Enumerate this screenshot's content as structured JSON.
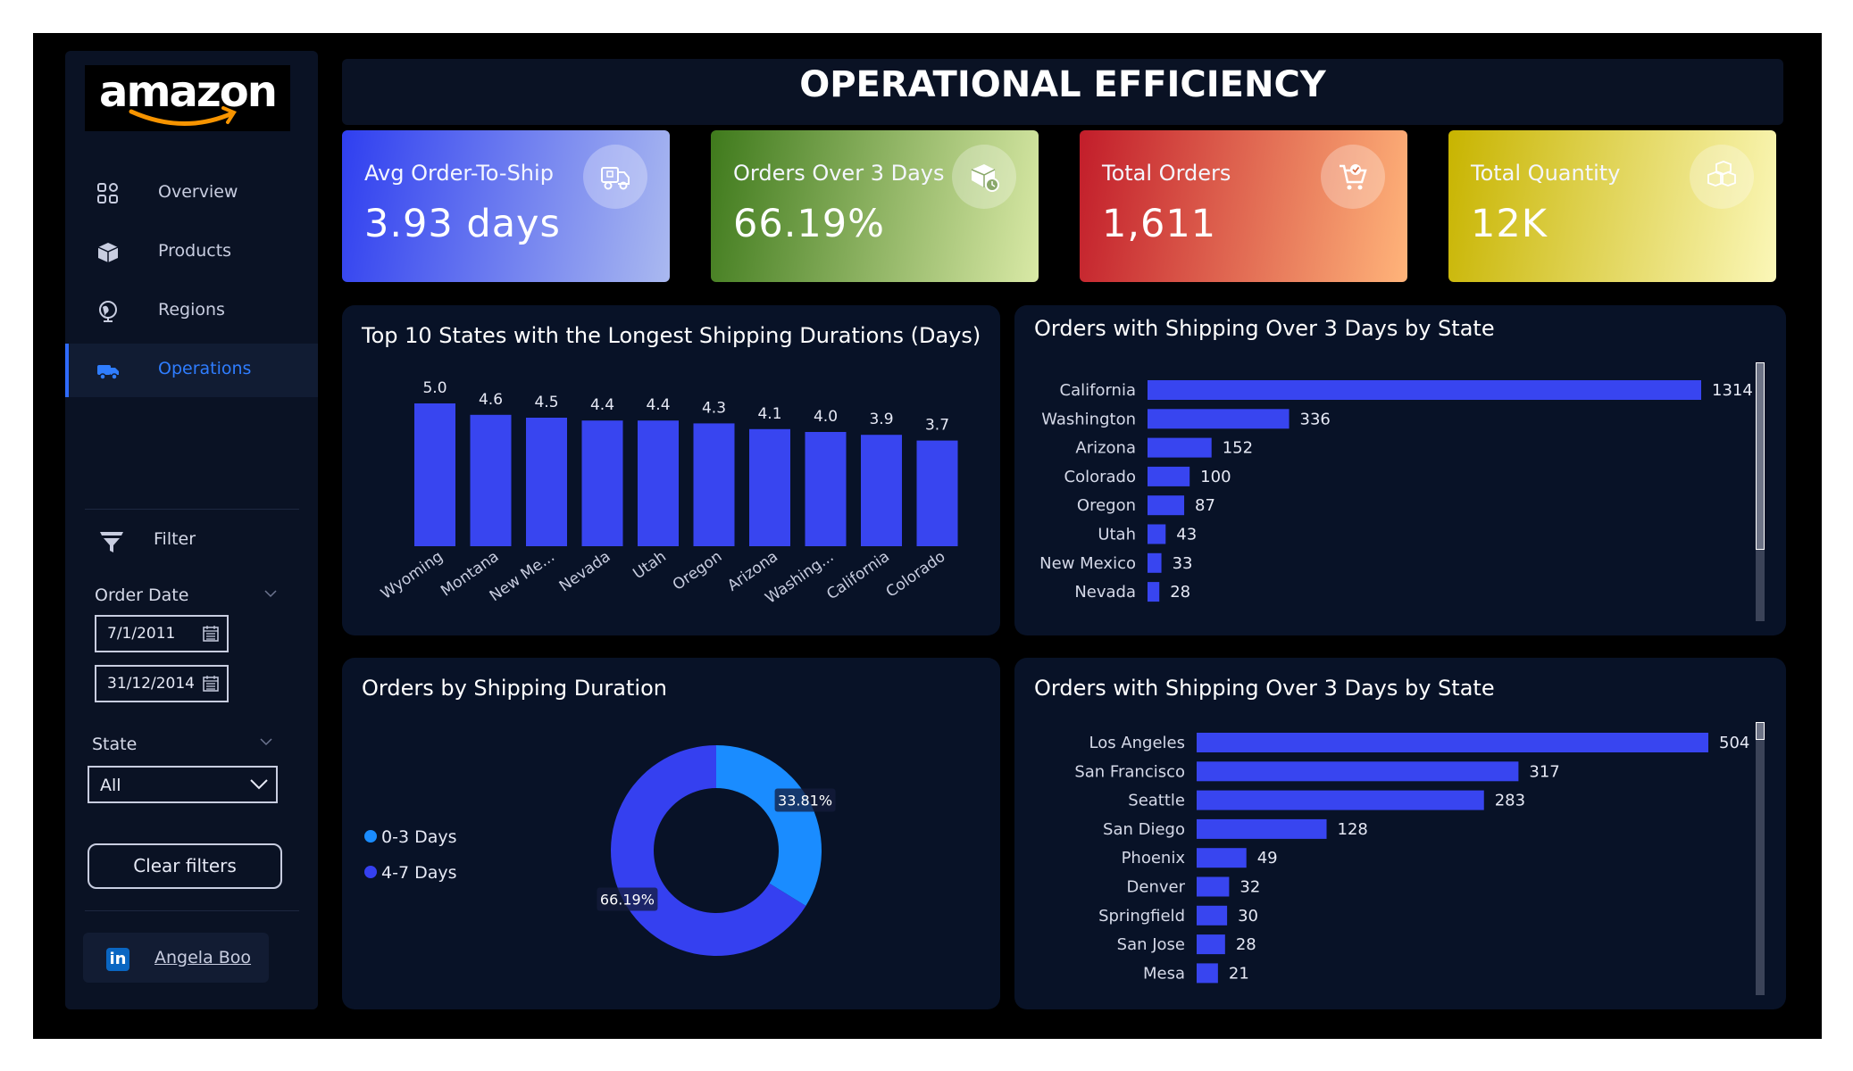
{
  "sidebar": {
    "logo": "amazon",
    "nav": [
      {
        "label": "Overview",
        "icon": "grid-icon"
      },
      {
        "label": "Products",
        "icon": "box-icon"
      },
      {
        "label": "Regions",
        "icon": "globe-icon"
      },
      {
        "label": "Operations",
        "icon": "truck-icon",
        "active": true
      }
    ],
    "filter_label": "Filter",
    "order_date_label": "Order Date",
    "date_from": "7/1/2011",
    "date_to": "31/12/2014",
    "state_label": "State",
    "state_value": "All",
    "clear_filters": "Clear filters",
    "linkedin_name": "Angela Boo"
  },
  "header": {
    "title": "OPERATIONAL EFFICIENCY"
  },
  "kpis": [
    {
      "label": "Avg Order-To-Ship",
      "value": "3.93 days",
      "icon": "delivery-truck-icon",
      "gradient": [
        "#2f3ff0",
        "#aab9f0"
      ]
    },
    {
      "label": "Orders Over 3 Days",
      "value": "66.19%",
      "icon": "package-clock-icon",
      "gradient": [
        "#3f7a1c",
        "#d9e9a6"
      ]
    },
    {
      "label": "Total Orders",
      "value": "1,611",
      "icon": "cart-check-icon",
      "gradient": [
        "#c21d2a",
        "#ffb47a"
      ]
    },
    {
      "label": "Total Quantity",
      "value": "12K",
      "icon": "boxes-icon",
      "gradient": [
        "#c8b400",
        "#fbf7b8"
      ]
    }
  ],
  "colors": {
    "bar": "#3845f0",
    "donut_a": "#1a8cff",
    "donut_b": "#3540f0",
    "panel": "#081227"
  },
  "chart_data": [
    {
      "type": "bar",
      "title": "Top 10 States with the Longest Shipping Durations (Days)",
      "categories": [
        "Wyoming",
        "Montana",
        "New Me...",
        "Nevada",
        "Utah",
        "Oregon",
        "Arizona",
        "Washing...",
        "California",
        "Colorado"
      ],
      "values": [
        5.0,
        4.6,
        4.5,
        4.4,
        4.4,
        4.3,
        4.1,
        4.0,
        3.9,
        3.7
      ],
      "value_labels": [
        "5.0",
        "4.6",
        "4.5",
        "4.4",
        "4.4",
        "4.3",
        "4.1",
        "4.0",
        "3.9",
        "3.7"
      ]
    },
    {
      "type": "bar",
      "orientation": "horizontal",
      "title": "Orders with Shipping Over 3 Days by State",
      "categories": [
        "California",
        "Washington",
        "Arizona",
        "Colorado",
        "Oregon",
        "Utah",
        "New Mexico",
        "Nevada"
      ],
      "values": [
        1314,
        336,
        152,
        100,
        87,
        43,
        33,
        28
      ]
    },
    {
      "type": "pie",
      "title": "Orders by Shipping Duration",
      "categories": [
        "0-3 Days",
        "4-7 Days"
      ],
      "values": [
        33.81,
        66.19
      ],
      "value_labels": [
        "33.81%",
        "66.19%"
      ]
    },
    {
      "type": "bar",
      "orientation": "horizontal",
      "title": "Orders with Shipping Over 3 Days by State",
      "categories": [
        "Los Angeles",
        "San Francisco",
        "Seattle",
        "San Diego",
        "Phoenix",
        "Denver",
        "Springfield",
        "San Jose",
        "Mesa"
      ],
      "values": [
        504,
        317,
        283,
        128,
        49,
        32,
        30,
        28,
        21
      ]
    }
  ]
}
